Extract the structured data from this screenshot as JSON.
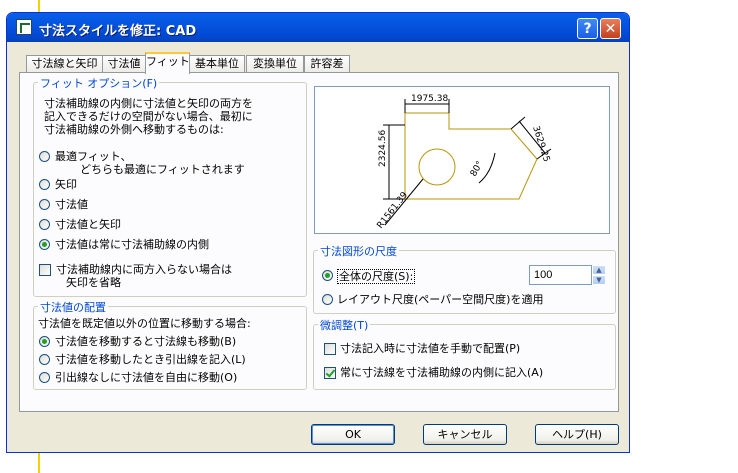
{
  "window": {
    "title": "寸法スタイルを修正: CAD",
    "help_glyph": "?",
    "close_glyph": "✕"
  },
  "tabs": [
    "寸法線と矢印",
    "寸法値",
    "フィット",
    "基本単位",
    "変換単位",
    "許容差"
  ],
  "fit_options": {
    "label": "フィット オプション(F)",
    "description": [
      "寸法補助線の内側に寸法値と矢印の両方を",
      "記入できるだけの空間がない場合、最初に",
      "寸法補助線の外側へ移動するものは:"
    ],
    "radios": [
      {
        "label": "最適フィット、",
        "sub": "どちらも最適にフィットされます",
        "selected": false
      },
      {
        "label": "矢印",
        "selected": false
      },
      {
        "label": "寸法値",
        "selected": false
      },
      {
        "label": "寸法値と矢印",
        "selected": false
      },
      {
        "label": "寸法値は常に寸法補助線の内側",
        "selected": true
      }
    ],
    "checkbox": {
      "label": "寸法補助線内に両方入らない場合は",
      "sub": "矢印を省略",
      "checked": false
    }
  },
  "text_placement": {
    "label": "寸法値の配置",
    "description": "寸法値を既定値以外の位置に移動する場合:",
    "radios": [
      {
        "label": "寸法値を移動すると寸法線も移動(B)",
        "selected": true
      },
      {
        "label": "寸法値を移動したとき引出線を記入(L)",
        "selected": false
      },
      {
        "label": "引出線なしに寸法値を自由に移動(O)",
        "selected": false
      }
    ]
  },
  "preview": {
    "dim_top": "1975.38",
    "dim_left": "2324.56",
    "dim_right": "3629.25",
    "dim_angle": "80°",
    "dim_radius": "R1561.39"
  },
  "scale": {
    "label": "寸法図形の尺度",
    "overall_label": "全体の尺度(S):",
    "overall_selected": true,
    "overall_value": "100",
    "layout_label": "レイアウト尺度(ペーパー空間尺度)を適用",
    "layout_selected": false
  },
  "fine_tuning": {
    "label": "微調整(T)",
    "options": [
      {
        "label": "寸法記入時に寸法値を手動で配置(P)",
        "checked": false
      },
      {
        "label": "常に寸法線を寸法補助線の内側に記入(A)",
        "checked": true
      }
    ]
  },
  "buttons": {
    "ok": "OK",
    "cancel": "キャンセル",
    "help": "ヘルプ(H)"
  },
  "colors": {
    "accent": "#0046d5",
    "title_bar": "#0454e0",
    "preview_line": "#b8960a"
  }
}
